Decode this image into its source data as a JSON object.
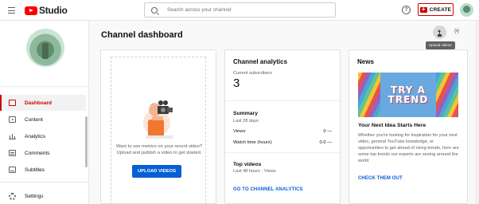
{
  "header": {
    "logo_text": "Studio",
    "search_placeholder": "Search across your channel",
    "help_label": "?",
    "create_label": "CREATE"
  },
  "sidebar": {
    "items": [
      {
        "label": "Dashboard",
        "icon": "dashboard-icon",
        "active": true
      },
      {
        "label": "Content",
        "icon": "content-icon",
        "active": false
      },
      {
        "label": "Analytics",
        "icon": "analytics-icon",
        "active": false
      },
      {
        "label": "Comments",
        "icon": "comments-icon",
        "active": false
      },
      {
        "label": "Subtitles",
        "icon": "subtitles-icon",
        "active": false
      }
    ],
    "settings_label": "Settings"
  },
  "main": {
    "title": "Channel dashboard",
    "upload_tooltip": "Upload videos",
    "live_icon": "(•)"
  },
  "upload_card": {
    "prompt": "Want to see metrics on your recent video? Upload and publish a video to get started.",
    "button_label": "UPLOAD VIDEOS"
  },
  "analytics_card": {
    "title": "Channel analytics",
    "subscribers_label": "Current subscribers",
    "subscribers_value": "3",
    "summary_title": "Summary",
    "summary_period": "Last 28 days",
    "rows": [
      {
        "label": "Views",
        "value": "0 —"
      },
      {
        "label": "Watch time (hours)",
        "value": "0.0 —"
      }
    ],
    "top_videos_title": "Top videos",
    "top_videos_period": "Last 48 hours · Views",
    "link_label": "GO TO CHANNEL ANALYTICS"
  },
  "news_card": {
    "title": "News",
    "image_lines": [
      "TRY A",
      "TREND"
    ],
    "headline": "Your Next Idea Starts Here",
    "body": "Whether you're looking for inspiration for your next video, general YouTube knowledge, or opportunities to get ahead of rising trends, here are some top trends our experts are seeing around the world",
    "link_label": "CHECK THEM OUT"
  },
  "colors": {
    "brand_red": "#ff0000",
    "accent_blue": "#065fd4",
    "active_red": "#cc0000"
  }
}
